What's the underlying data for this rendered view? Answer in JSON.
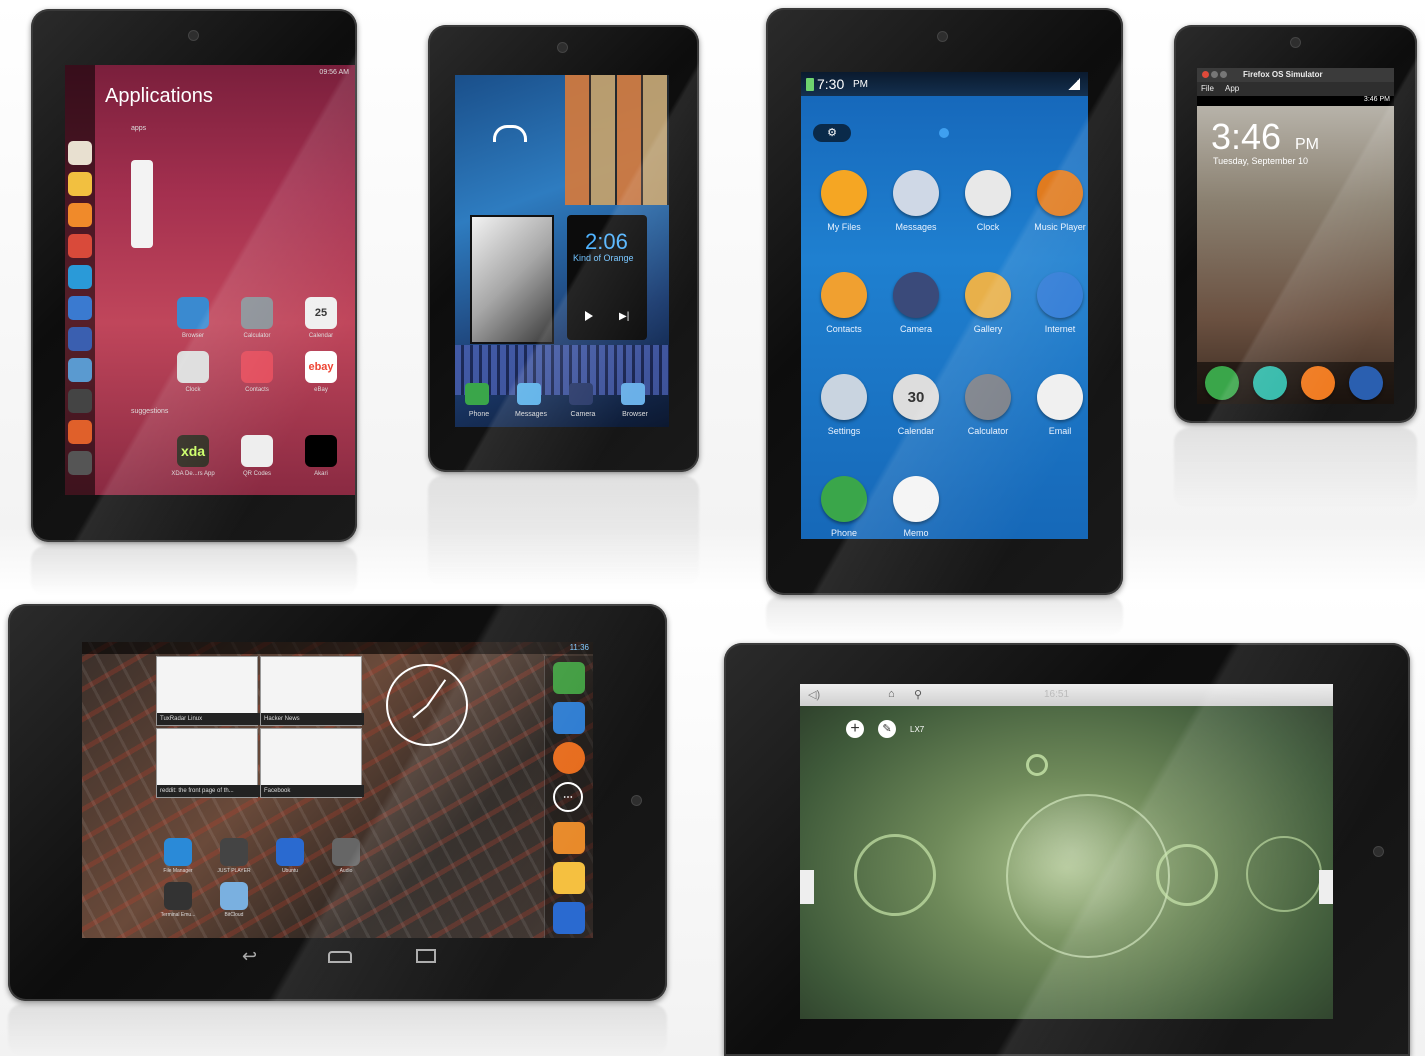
{
  "ubuntu": {
    "status_time": "09:56 AM",
    "title": "Applications",
    "section_apps": "apps",
    "section_suggestions": "suggestions",
    "launcher_icons": [
      "calendar-icon",
      "notes-icon",
      "weather-icon",
      "gmail-icon",
      "twitter-icon",
      "globe-icon",
      "facebook-icon",
      "gallery-icon",
      "camera-icon",
      "phone-icon",
      "settings-icon"
    ],
    "apps": [
      {
        "label": "Browser",
        "icon": "globe-icon"
      },
      {
        "label": "Calculator",
        "icon": "calculator-icon"
      },
      {
        "label": "Calendar",
        "icon": "calendar-icon",
        "text": "25"
      },
      {
        "label": "Clock",
        "icon": "clock-icon"
      },
      {
        "label": "Contacts",
        "icon": "contacts-icon"
      },
      {
        "label": "eBay",
        "icon": "ebay-icon",
        "text": "ebay"
      },
      {
        "label": "XDA De...rs App",
        "icon": "xda-icon",
        "text": "xda"
      },
      {
        "label": "QR Codes",
        "icon": "qr-icon"
      },
      {
        "label": "Akari",
        "icon": "bulb-icon"
      }
    ],
    "calendar_day": "25"
  },
  "sailfish": {
    "clock": "2:06",
    "song": "Kind of Orange",
    "dock": [
      "Phone",
      "Messages",
      "Camera",
      "Browser"
    ]
  },
  "tizen": {
    "status_time": "7:30",
    "status_ampm": "PM",
    "apps": [
      {
        "label": "My Files",
        "color": "#f5a623"
      },
      {
        "label": "Messages",
        "color": "#cfd8e6"
      },
      {
        "label": "Clock",
        "color": "#e8e8e8"
      },
      {
        "label": "Music Player",
        "color": "#e07b1f"
      },
      {
        "label": "Contacts",
        "color": "#f0a030"
      },
      {
        "label": "Camera",
        "color": "#3a4a7a"
      },
      {
        "label": "Gallery",
        "color": "#e8b04a"
      },
      {
        "label": "Internet",
        "color": "#2f7bd6"
      },
      {
        "label": "Settings",
        "color": "#c9d4e0"
      },
      {
        "label": "Calendar",
        "color": "#dddddd",
        "text": "30"
      },
      {
        "label": "Calculator",
        "color": "#7a7f88"
      },
      {
        "label": "Email",
        "color": "#f0f0f0"
      },
      {
        "label": "Phone",
        "color": "#3aa64a"
      },
      {
        "label": "Memo",
        "color": "#f4f4f4"
      }
    ]
  },
  "firefox": {
    "window_title": "Firefox OS Simulator",
    "menu": [
      "File",
      "App"
    ],
    "status_time": "3:46 PM",
    "lock_time": "3:46",
    "lock_ampm": "PM",
    "lock_date": "Tuesday, September 10",
    "dock_colors": [
      "#3aa64a",
      "#2fb8a8",
      "#f07a1f",
      "#2a5fb0"
    ]
  },
  "android": {
    "status_time": "11:36",
    "recents": [
      "TuxRadar Linux",
      "Hacker News",
      "reddit: the front page of th...",
      "Facebook"
    ],
    "apps": [
      "File Manager",
      "JUST PLAYER",
      "Ubuntu",
      "Audio",
      "Terminal Emu...",
      "BitCloud"
    ]
  },
  "meego": {
    "label": "LX7",
    "time": "16:51"
  }
}
